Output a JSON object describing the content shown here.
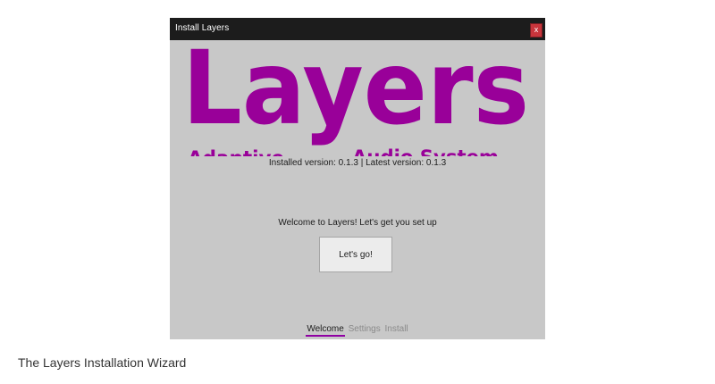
{
  "window": {
    "title": "Install Layers",
    "close_glyph": "x"
  },
  "logo": {
    "word": "Layers",
    "subtitle_left": "Adaptive",
    "subtitle_right": "Audio System",
    "color": "#990099"
  },
  "version_info": "Installed version: 0.1.3 | Latest version: 0.1.3",
  "welcome_text": "Welcome to Layers! Let's get you set up",
  "start_button": "Let's go!",
  "steps": [
    {
      "label": "Welcome",
      "active": true
    },
    {
      "label": "Settings",
      "active": false
    },
    {
      "label": "Install",
      "active": false
    }
  ],
  "caption": "The Layers Installation Wizard",
  "colors": {
    "window_bg": "#c8c8c8",
    "titlebar_bg": "#1c1c1c",
    "close_bg": "#c8353c",
    "accent": "#8f00a3"
  }
}
